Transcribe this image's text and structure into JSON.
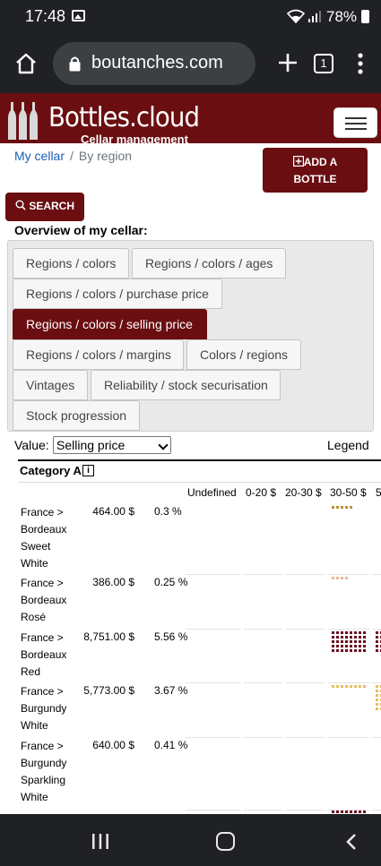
{
  "status_bar": {
    "time": "17:48",
    "battery": "78%"
  },
  "browser": {
    "url": "boutanches.com",
    "tab_count": "1"
  },
  "header": {
    "logo_text": "Bottles.cloud",
    "logo_subtitle": "Cellar management"
  },
  "breadcrumb": {
    "root": "My cellar",
    "current": "By region"
  },
  "buttons": {
    "add_bottle_line1": "ADD A",
    "add_bottle_line2": "BOTTLE",
    "search": "SEARCH"
  },
  "overview_title": "Overview of my cellar:",
  "tabs": [
    "Regions / colors",
    "Regions / colors / ages",
    "Regions / colors / purchase price",
    "Regions / colors / selling price",
    "Regions / colors / margins",
    "Colors / regions",
    "Vintages",
    "Reliability / stock securisation",
    "Stock progression"
  ],
  "active_tab": "Regions / colors / selling price",
  "value_filter": {
    "label": "Value:",
    "selected": "Selling price"
  },
  "legend_label": "Legend",
  "table": {
    "category": "Category A",
    "info_icon_label": "i",
    "columns": [
      "Undefined",
      "0-20 $",
      "20-30 $",
      "30-50 $",
      "5"
    ],
    "rows": [
      {
        "name_lines": [
          "France >",
          "Bordeaux",
          "Sweet",
          "White"
        ],
        "value": "464.00 $",
        "percent": "0.3 %",
        "color": "#b8922e",
        "dots_30_50": 5
      },
      {
        "name_lines": [
          "France >",
          "Bordeaux",
          "Rosé"
        ],
        "value": "386.00 $",
        "percent": "0.25 %",
        "color": "#e8b79e",
        "dots_30_50": 4
      },
      {
        "name_lines": [
          "France >",
          "Bordeaux",
          "Red"
        ],
        "value": "8,751.00 $",
        "percent": "5.56 %",
        "color": "#6a0e22",
        "dots_30_50": 40
      },
      {
        "name_lines": [
          "France >",
          "Burgundy",
          "White"
        ],
        "value": "5,773.00 $",
        "percent": "3.67 %",
        "color": "#e3be64",
        "dots_30_50": 8
      },
      {
        "name_lines": [
          "France >",
          "Burgundy",
          "Sparkling",
          "White"
        ],
        "value": "640.00 $",
        "percent": "0.41 %",
        "color": "#e3be64",
        "dots_30_50": 0
      }
    ]
  },
  "colors": {
    "brand": "#6a0e12",
    "link": "#1a5fb4"
  }
}
